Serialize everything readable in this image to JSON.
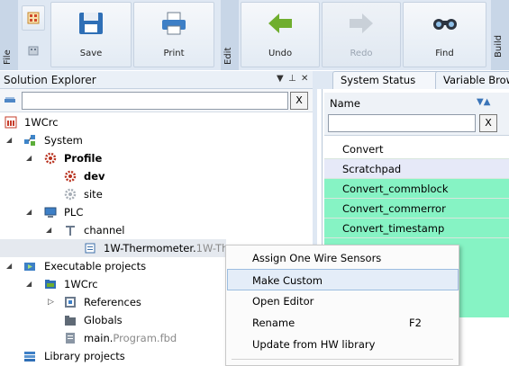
{
  "ribbon": {
    "groups": {
      "file": "File",
      "edit": "Edit",
      "build": "Build"
    },
    "buttons": {
      "save": "Save",
      "print": "Print",
      "undo": "Undo",
      "redo": "Redo",
      "find": "Find"
    }
  },
  "solution_explorer": {
    "title": "Solution Explorer",
    "pin_glyph": "▾ ᵖ ✕",
    "filter_clear": "X",
    "tree": {
      "root": "1WCrc",
      "system": "System",
      "profile": "Profile",
      "dev": "dev",
      "site": "site",
      "plc": "PLC",
      "channel": "channel",
      "thermo_name": "1W-Thermometer.",
      "thermo_type": "1W-Th",
      "executable": "Executable projects",
      "exe_1wcrc": "1WCrc",
      "references": "References",
      "globals": "Globals",
      "main_name": "main.",
      "main_type": "Program.fbd",
      "library": "Library projects"
    }
  },
  "right_pane": {
    "tabs": [
      "System Status",
      "Variable Brows"
    ],
    "column_name": "Name",
    "filter_clear": "X",
    "rows": [
      "Convert",
      "Scratchpad",
      "Convert_commblock",
      "Convert_commerror",
      "Convert_timestamp"
    ],
    "colors": {
      "row_default": "#ffffff",
      "row_selected": "#e6e9f8",
      "row_green": "#86f3c4"
    }
  },
  "context_menu": {
    "items": [
      {
        "label": "Assign One Wire Sensors",
        "shortcut": ""
      },
      {
        "label": "Make Custom",
        "shortcut": ""
      },
      {
        "label": "Open Editor",
        "shortcut": ""
      },
      {
        "label": "Rename",
        "shortcut": "F2"
      },
      {
        "label": "Update from HW library",
        "shortcut": ""
      }
    ]
  }
}
